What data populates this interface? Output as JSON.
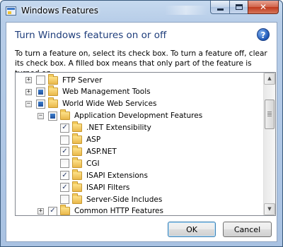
{
  "window": {
    "title": "Windows Features",
    "close_glyph": "✕"
  },
  "dialog": {
    "heading": "Turn Windows features on or off",
    "help_glyph": "?",
    "description": "To turn a feature on, select its check box. To turn a feature off, clear its check box. A filled box means that only part of the feature is turned on."
  },
  "tree": {
    "items": [
      {
        "label": "FTP Server",
        "level": 0,
        "expander": "+",
        "state": "unchecked"
      },
      {
        "label": "Web Management Tools",
        "level": 0,
        "expander": "+",
        "state": "partial"
      },
      {
        "label": "World Wide Web Services",
        "level": 0,
        "expander": "−",
        "state": "partial"
      },
      {
        "label": "Application Development Features",
        "level": 1,
        "expander": "−",
        "state": "partial"
      },
      {
        "label": ".NET Extensibility",
        "level": 2,
        "expander": "",
        "state": "checked"
      },
      {
        "label": "ASP",
        "level": 2,
        "expander": "",
        "state": "unchecked"
      },
      {
        "label": "ASP.NET",
        "level": 2,
        "expander": "",
        "state": "checked"
      },
      {
        "label": "CGI",
        "level": 2,
        "expander": "",
        "state": "unchecked"
      },
      {
        "label": "ISAPI Extensions",
        "level": 2,
        "expander": "",
        "state": "checked"
      },
      {
        "label": "ISAPI Filters",
        "level": 2,
        "expander": "",
        "state": "checked"
      },
      {
        "label": "Server-Side Includes",
        "level": 2,
        "expander": "",
        "state": "unchecked"
      },
      {
        "label": "Common HTTP Features",
        "level": 1,
        "expander": "+",
        "state": "checked"
      }
    ],
    "check_glyph": "✓",
    "scroll_up_glyph": "▲",
    "scroll_down_glyph": "▼"
  },
  "buttons": {
    "ok_label": "OK",
    "cancel_label": "Cancel"
  },
  "colors": {
    "heading": "#1e3d7b",
    "partial_fill": "#2f67b8",
    "folder": "#f3cb5e"
  }
}
